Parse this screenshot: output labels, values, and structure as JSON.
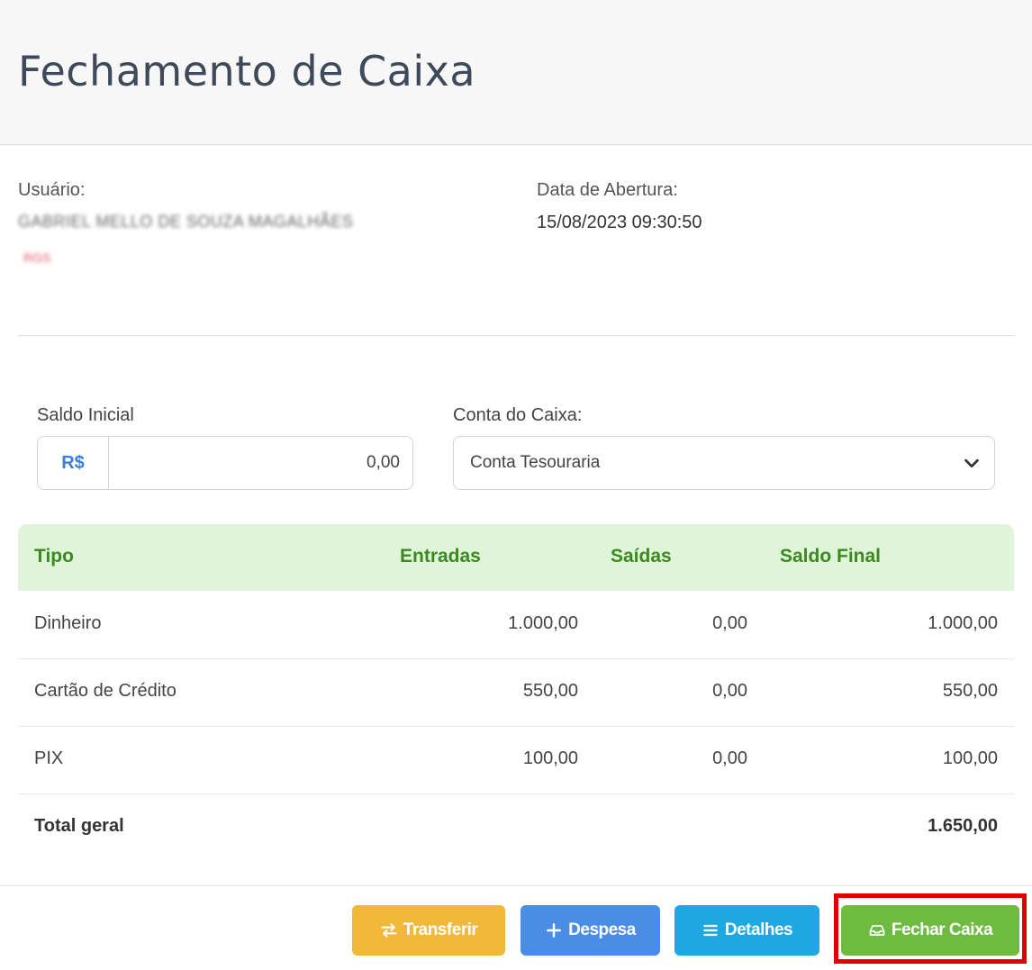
{
  "header": {
    "title": "Fechamento de Caixa"
  },
  "info": {
    "user_label": "Usuário:",
    "user_name": "GABRIEL MELLO DE SOUZA MAGALHÃES",
    "user_role": "RGS",
    "open_date_label": "Data de Abertura:",
    "open_date_value": "15/08/2023 09:30:50"
  },
  "form": {
    "saldo_label": "Saldo Inicial",
    "currency_addon": "R$",
    "saldo_value": "0,00",
    "conta_label": "Conta do Caixa:",
    "conta_value": "Conta Tesouraria"
  },
  "table": {
    "headers": [
      "Tipo",
      "Entradas",
      "Saídas",
      "Saldo Final"
    ],
    "rows": [
      {
        "tipo": "Dinheiro",
        "entradas": "1.000,00",
        "saidas": "0,00",
        "saldo": "1.000,00"
      },
      {
        "tipo": "Cartão de Crédito",
        "entradas": "550,00",
        "saidas": "0,00",
        "saldo": "550,00"
      },
      {
        "tipo": "PIX",
        "entradas": "100,00",
        "saidas": "0,00",
        "saldo": "100,00"
      }
    ],
    "total_label": "Total geral",
    "total_value": "1.650,00"
  },
  "buttons": {
    "transferir": "Transferir",
    "despesa": "Despesa",
    "detalhes": "Detalhes",
    "fechar": "Fechar Caixa"
  },
  "colors": {
    "transferir": "#f2b83a",
    "despesa": "#4a8de6",
    "detalhes": "#1ea7e1",
    "fechar": "#6dbb3f",
    "table_header_bg": "#dff4d8",
    "table_header_text": "#3b8a1f",
    "highlight": "#e00000"
  },
  "icons": {
    "transferir": "exchange-icon",
    "despesa": "plus-icon",
    "detalhes": "list-icon",
    "fechar": "inbox-icon",
    "select": "chevron-down-icon"
  }
}
